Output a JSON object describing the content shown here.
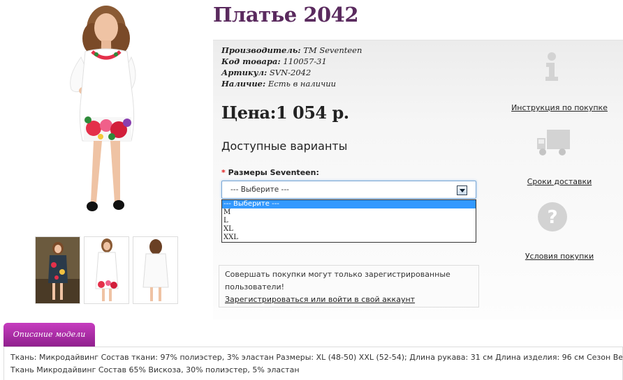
{
  "product": {
    "title": "Платье 2042",
    "meta": [
      {
        "label": "Производитель:",
        "value": "TM Seventeen"
      },
      {
        "label": "Код товара:",
        "value": "110057-31"
      },
      {
        "label": "Артикул:",
        "value": "SVN-2042"
      },
      {
        "label": "Наличие:",
        "value": "Есть в наличии"
      }
    ],
    "price": "Цена:1 054 р."
  },
  "options": {
    "heading": "Доступные варианты",
    "required_mark": "*",
    "size_label": "Размеры Seventeen:",
    "selected": "--- Выберите ---",
    "list": [
      "--- Выберите ---",
      "M",
      "L",
      "XL",
      "XXL"
    ]
  },
  "notice": {
    "text_line1": "Совершать покупки могут только зарегистрированные",
    "text_line2": "пользователи!",
    "link": "Зарегистрироваться или войти в свой аккаунт"
  },
  "side_links": {
    "instruction": "Инструкция по покупке",
    "delivery": "Сроки доставки",
    "terms": "Условия покупки"
  },
  "description": {
    "tab": "Описание модели",
    "line1": "Ткань: Микродайвинг Состав ткани: 97% полиэстер, 3% эластан Размеры: XL (48-50) XXL (52-54); Длина рукава: 31 см Длина изделия: 96 см Сезон Весна/осень",
    "line2": "Ткань Микродайвинг Состав 65% Вискоза, 30% полиэстер, 5% эластан"
  },
  "colors": {
    "title": "#5a2a5e",
    "tab": "#a82aa4",
    "select_highlight": "#3399ff",
    "icon_gray": "#d6d6d6"
  }
}
